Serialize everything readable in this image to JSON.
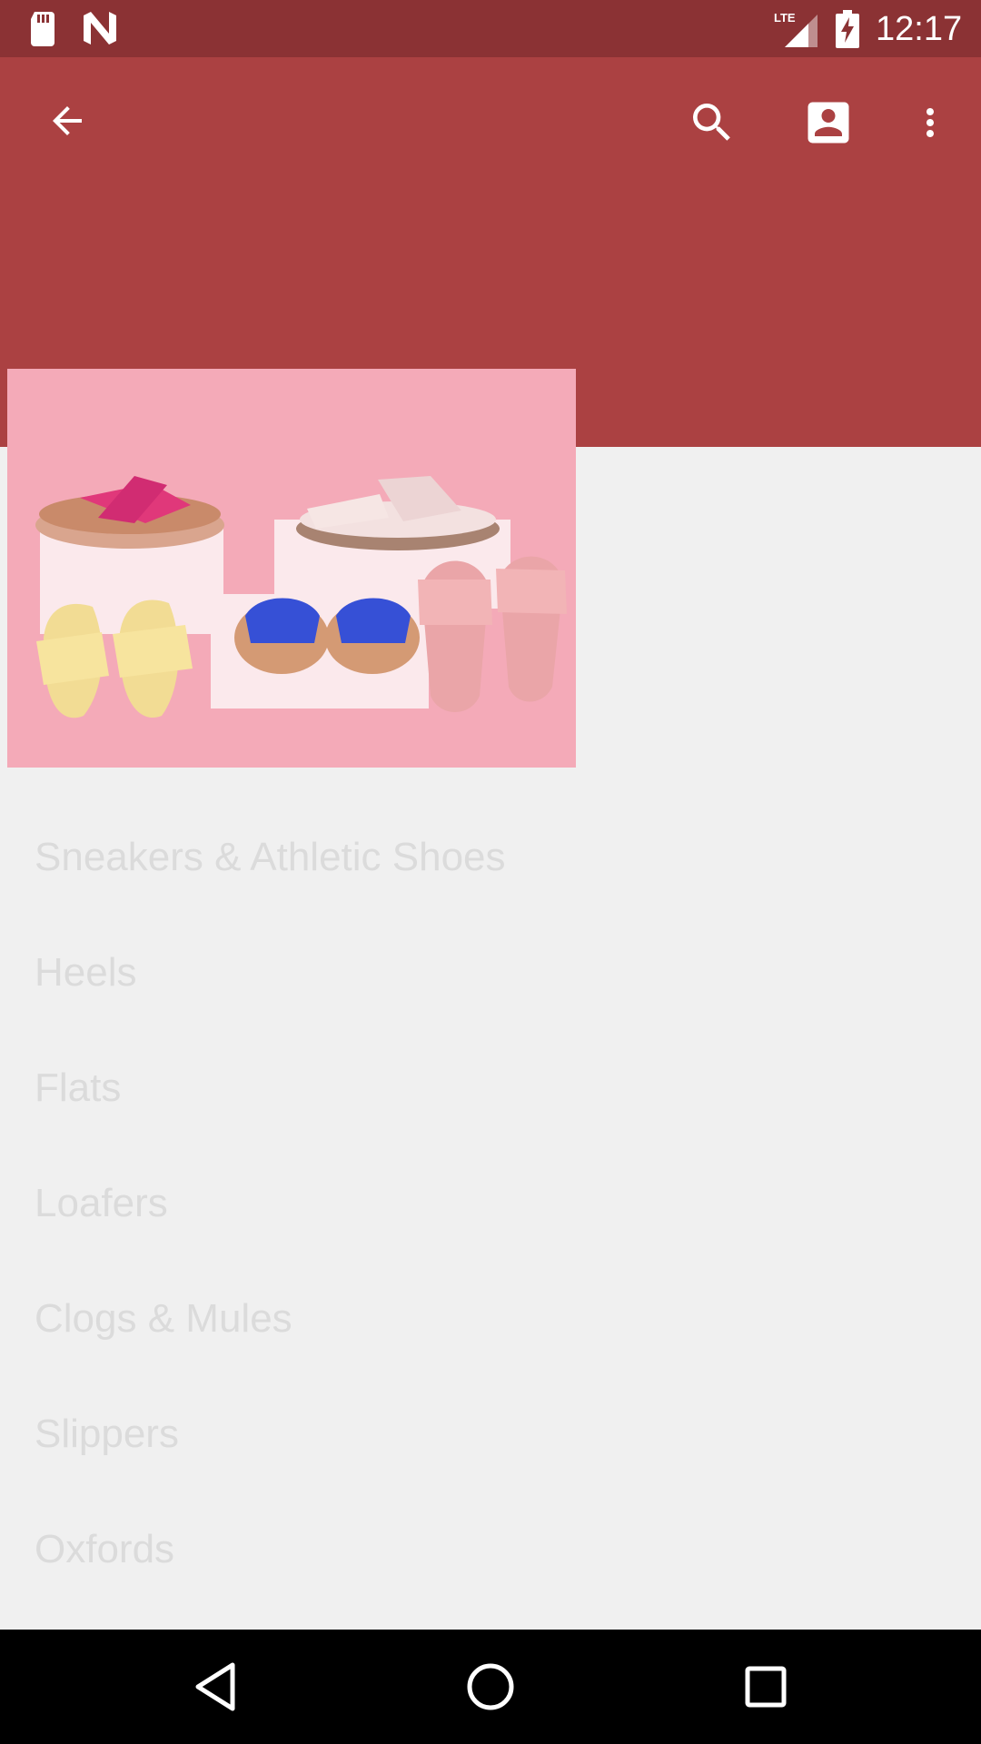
{
  "status_bar": {
    "time": "12:17",
    "network": "LTE",
    "icons": [
      "sd-card-icon",
      "n-notification-icon",
      "lte-signal-icon",
      "battery-charging-icon"
    ]
  },
  "toolbar": {
    "icons": [
      "arrow-back-icon",
      "search-icon",
      "account-box-icon",
      "more-vert-icon"
    ],
    "colors": {
      "status_bar": "#8b3234",
      "toolbar": "#ab4142",
      "hero_bg": "#f4aab8"
    }
  },
  "categories": [
    {
      "label": "Sneakers & Athletic Shoes"
    },
    {
      "label": "Heels"
    },
    {
      "label": "Flats"
    },
    {
      "label": "Loafers"
    },
    {
      "label": "Clogs & Mules"
    },
    {
      "label": "Slippers"
    },
    {
      "label": "Oxfords"
    }
  ],
  "nav_bar": {
    "icons": [
      "nav-back-icon",
      "nav-home-icon",
      "nav-recents-icon"
    ]
  }
}
